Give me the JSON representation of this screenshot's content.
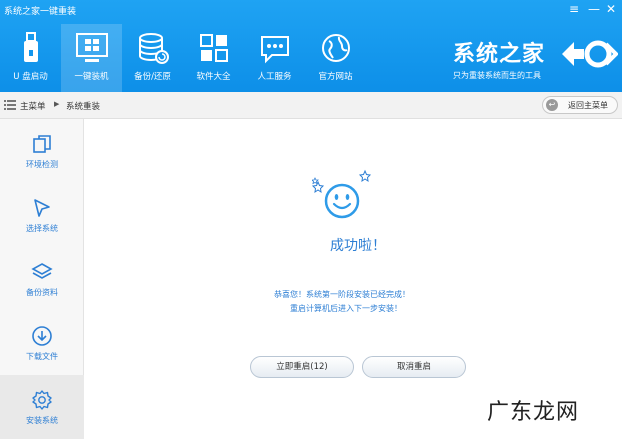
{
  "window": {
    "title": "系统之家一键重装",
    "menu_glyph": "≡",
    "min_glyph": "—",
    "close_glyph": "✕"
  },
  "nav": {
    "items": [
      {
        "label": "U 盘启动",
        "icon": "usb-drive-icon"
      },
      {
        "label": "一键装机",
        "icon": "monitor-windows-icon",
        "active": true
      },
      {
        "label": "备份/还原",
        "icon": "database-restore-icon"
      },
      {
        "label": "软件大全",
        "icon": "app-grid-icon"
      },
      {
        "label": "人工服务",
        "icon": "chat-bubble-icon"
      },
      {
        "label": "官方网站",
        "icon": "globe-icon"
      }
    ]
  },
  "brand": {
    "name": "系统之家",
    "slogan": "只为重装系统而生的工具"
  },
  "breadcrumb": {
    "home": "主菜单",
    "separator": "▶",
    "current": "系统重装",
    "back_label": "返回主菜单"
  },
  "sidebar": {
    "items": [
      {
        "label": "环境检测",
        "icon": "copy-icon"
      },
      {
        "label": "选择系统",
        "icon": "cursor-icon"
      },
      {
        "label": "备份资料",
        "icon": "layers-icon"
      },
      {
        "label": "下载文件",
        "icon": "download-icon"
      },
      {
        "label": "安装系统",
        "icon": "gear-icon",
        "active": true
      }
    ]
  },
  "main": {
    "success_text": "成功啦！",
    "message_line1": "恭喜您！系统第一阶段安装已经完成！",
    "message_line2": "重启计算机后进入下一步安装！",
    "restart_button": "立即重启(12)",
    "cancel_button": "取消重启"
  },
  "watermark": {
    "text": "广东龙网"
  },
  "colors": {
    "topbar": "#1296ee",
    "accent_blue": "#2e7fd4"
  }
}
